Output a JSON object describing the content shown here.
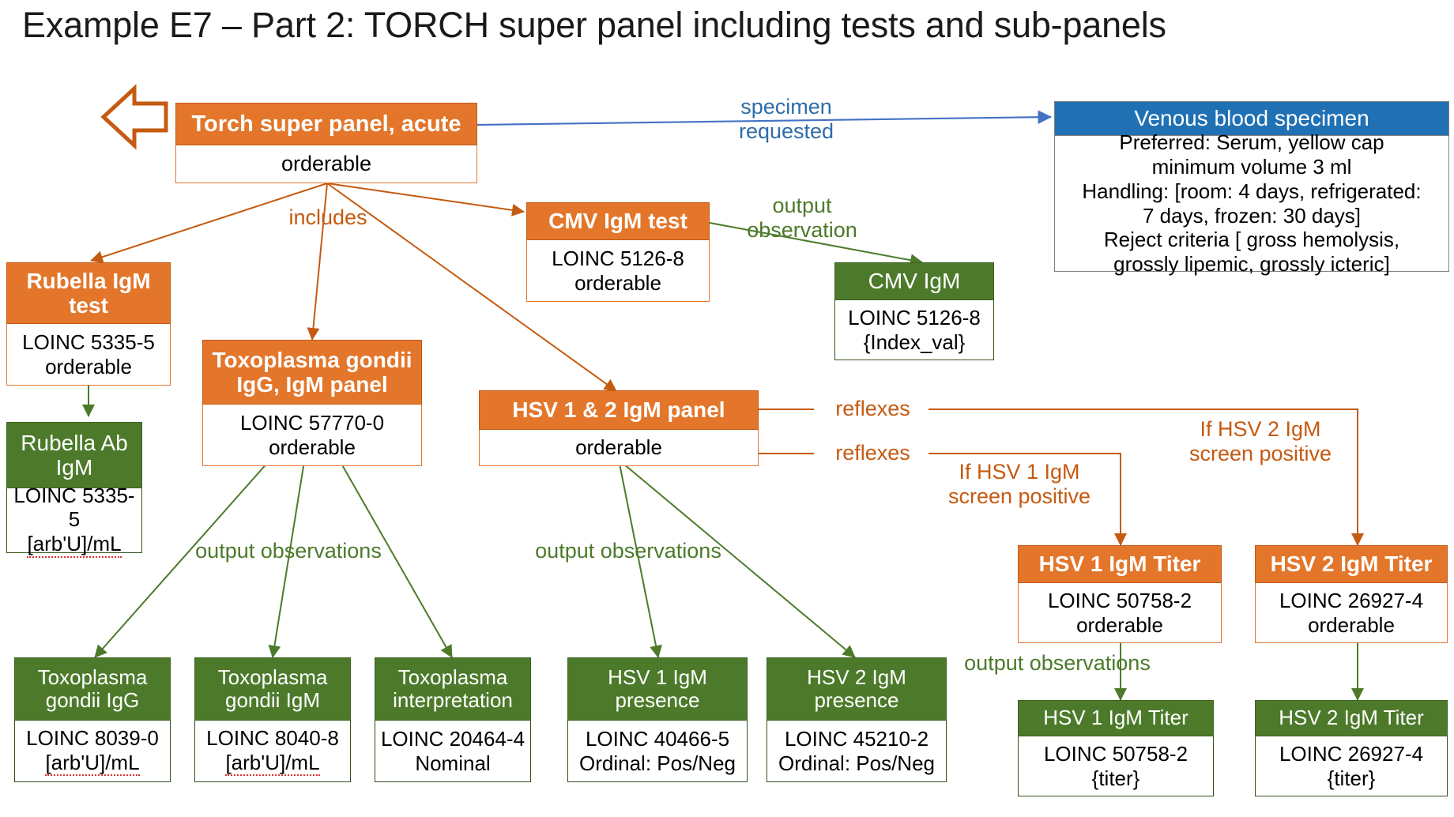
{
  "title": "Example E7 – Part 2: TORCH super panel  including tests and sub-panels",
  "colors": {
    "orange": "#E3762A",
    "orange_text": "#C55A11",
    "green": "#4C7A2A",
    "blue": "#2070B4",
    "white": "#FFFFFF"
  },
  "nodes": {
    "torch_panel": {
      "title": "Torch super panel, acute",
      "line1": "orderable",
      "line2": "",
      "kind": "orange"
    },
    "venous_specimen": {
      "title": "Venous blood specimen",
      "line1": "Preferred: Serum, yellow cap",
      "line2": "minimum volume 3 ml",
      "line3": "Handling: [room: 4 days, refrigerated:",
      "line4": "7 days, frozen: 30 days]",
      "line5": "Reject criteria [ gross hemolysis,",
      "line6": "grossly lipemic, grossly icteric]",
      "kind": "blue"
    },
    "cmv_test": {
      "title": "CMV IgM test",
      "line1": "LOINC 5126-8",
      "line2": "orderable",
      "kind": "orange"
    },
    "cmv_obs": {
      "title": "CMV IgM",
      "line1": "LOINC 5126-8",
      "line2": "{Index_val}",
      "kind": "green"
    },
    "rubella_test": {
      "title": "Rubella IgM test",
      "line1": "LOINC 5335-5",
      "line2": "orderable",
      "kind": "orange"
    },
    "rubella_obs": {
      "title": "Rubella Ab IgM",
      "line1": "LOINC 5335-5",
      "line2": "[arb'U]/mL",
      "kind": "green"
    },
    "toxo_panel": {
      "title": "Toxoplasma gondii IgG, IgM panel",
      "line1": "LOINC 57770-0",
      "line2": "orderable",
      "kind": "orange"
    },
    "hsv_panel": {
      "title": "HSV 1 & 2 IgM panel",
      "line1": "orderable",
      "line2": "",
      "kind": "orange"
    },
    "toxo_igg": {
      "title": "Toxoplasma gondii IgG",
      "line1": "LOINC 8039-0",
      "line2": "[arb'U]/mL",
      "kind": "green"
    },
    "toxo_igm": {
      "title": "Toxoplasma gondii IgM",
      "line1": "LOINC 8040-8",
      "line2": "[arb'U]/mL",
      "kind": "green"
    },
    "toxo_interp": {
      "title": "Toxoplasma interpretation",
      "line1": "LOINC 20464-4",
      "line2": "Nominal",
      "kind": "green"
    },
    "hsv1_presence": {
      "title": "HSV 1 IgM presence",
      "line1": "LOINC 40466-5",
      "line2": "Ordinal: Pos/Neg",
      "kind": "green"
    },
    "hsv2_presence": {
      "title": "HSV 2 IgM presence",
      "line1": "LOINC 45210-2",
      "line2": "Ordinal: Pos/Neg",
      "kind": "green"
    },
    "hsv1_titer_order": {
      "title": "HSV 1 IgM Titer",
      "line1": "LOINC 50758-2",
      "line2": "orderable",
      "kind": "orange"
    },
    "hsv2_titer_order": {
      "title": "HSV 2 IgM Titer",
      "line1": "LOINC 26927-4",
      "line2": "orderable",
      "kind": "orange"
    },
    "hsv1_titer_obs": {
      "title": "HSV 1 IgM Titer",
      "line1": "LOINC 50758-2",
      "line2": "{titer}",
      "kind": "green"
    },
    "hsv2_titer_obs": {
      "title": "HSV 2 IgM Titer",
      "line1": "LOINC 26927-4",
      "line2": "{titer}",
      "kind": "green"
    }
  },
  "edge_labels": {
    "specimen_requested": "specimen\nrequested",
    "includes": "includes",
    "output_observation": "output\nobservation",
    "output_observations_toxo": "output observations",
    "output_observations_hsv": "output observations",
    "output_observations_titer": "output observations",
    "reflexes_1": "reflexes",
    "reflexes_2": "reflexes",
    "if_hsv1": "If HSV 1 IgM\nscreen positive",
    "if_hsv2": "If HSV 2 IgM\nscreen positive"
  }
}
